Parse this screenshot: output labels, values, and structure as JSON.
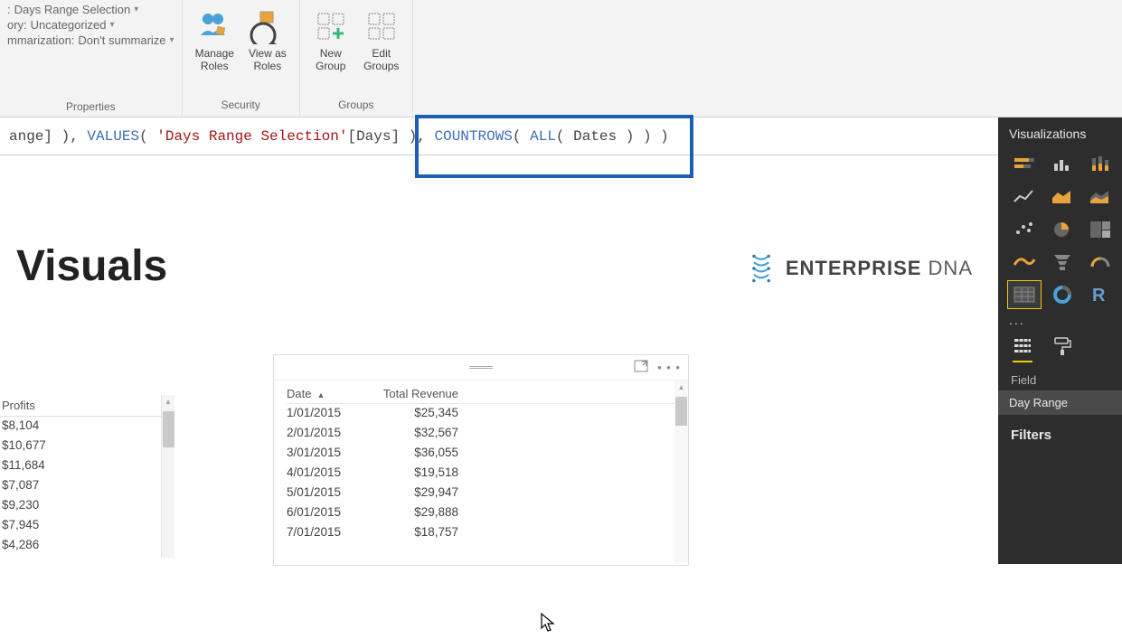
{
  "ribbon": {
    "properties": {
      "label": "Properties",
      "row1_prefix": ":",
      "row1_value": "Days Range Selection",
      "row2_prefix": "ory:",
      "row2_value": "Uncategorized",
      "row3_prefix": "mmarization:",
      "row3_value": "Don't summarize"
    },
    "security": {
      "label": "Security",
      "manage_roles": "Manage\nRoles",
      "view_as_roles": "View as\nRoles"
    },
    "groups": {
      "label": "Groups",
      "new_group": "New\nGroup",
      "edit_groups": "Edit\nGroups"
    }
  },
  "formula": {
    "parts": [
      {
        "t": "ange] ), ",
        "c": ""
      },
      {
        "t": "VALUES",
        "c": "fn"
      },
      {
        "t": "( ",
        "c": ""
      },
      {
        "t": "'Days Range Selection'",
        "c": "str"
      },
      {
        "t": "[Days] ), ",
        "c": ""
      },
      {
        "t": "COUNTROWS",
        "c": "fn"
      },
      {
        "t": "( ",
        "c": ""
      },
      {
        "t": "ALL",
        "c": "fn"
      },
      {
        "t": "( Dates ) ) )",
        "c": ""
      }
    ]
  },
  "canvas": {
    "title": "Visuals",
    "logo_text": "ENTERPRISE",
    "logo_text2": "DNA"
  },
  "left_table": {
    "header": "Profits",
    "rows": [
      "$8,104",
      "$10,677",
      "$11,684",
      "$7,087",
      "$9,230",
      "$7,945",
      "$4,286"
    ]
  },
  "center_table": {
    "col1": "Date",
    "col2": "Total Revenue",
    "rows": [
      {
        "date": "1/01/2015",
        "rev": "$25,345"
      },
      {
        "date": "2/01/2015",
        "rev": "$32,567"
      },
      {
        "date": "3/01/2015",
        "rev": "$36,055"
      },
      {
        "date": "4/01/2015",
        "rev": "$19,518"
      },
      {
        "date": "5/01/2015",
        "rev": "$29,947"
      },
      {
        "date": "6/01/2015",
        "rev": "$29,888"
      },
      {
        "date": "7/01/2015",
        "rev": "$18,757"
      }
    ]
  },
  "right_panel": {
    "title": "Visualizations",
    "more": "...",
    "field_label": "Field",
    "field_value": "Day Range",
    "filters_title": "Filters",
    "viz_icons": [
      "stacked-bar",
      "clustered-column",
      "stacked-column",
      "line",
      "area",
      "stacked-area",
      "scatter",
      "pie",
      "treemap",
      "ribbon",
      "funnel",
      "gauge",
      "table",
      "donut",
      "r-script"
    ]
  }
}
